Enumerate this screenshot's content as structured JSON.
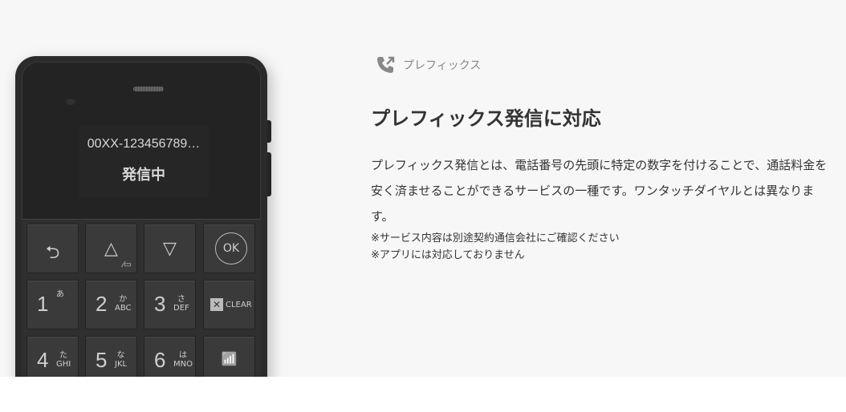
{
  "phone": {
    "display_number": "00XX-123456789…",
    "display_status": "発信中",
    "keys": [
      {
        "label": "back",
        "glyph": "⮌"
      },
      {
        "label": "up",
        "glyph": "△",
        "sub": "⁄▭"
      },
      {
        "label": "down",
        "glyph": "▽"
      },
      {
        "label": "ok",
        "glyph": "OK"
      },
      {
        "digit": "1",
        "kana": "あ",
        "alpha": ""
      },
      {
        "digit": "2",
        "kana": "か",
        "alpha": "ABC"
      },
      {
        "digit": "3",
        "kana": "さ",
        "alpha": "DEF"
      },
      {
        "label": "clear",
        "glyph": "✕",
        "text": "CLEAR"
      },
      {
        "digit": "4",
        "kana": "た",
        "alpha": "GHI"
      },
      {
        "digit": "5",
        "kana": "な",
        "alpha": "JKL"
      },
      {
        "digit": "6",
        "kana": "は",
        "alpha": "MNO"
      },
      {
        "label": "tethering",
        "glyph": "📶"
      }
    ]
  },
  "feature": {
    "icon": "phone-prefix-icon",
    "tag": "プレフィックス",
    "title": "プレフィックス発信に対応",
    "body": "プレフィックス発信とは、電話番号の先頭に特定の数字を付けることで、通話料金を安く済ませることができるサービスの一種です。ワンタッチダイヤルとは異なります。",
    "notes": [
      "※サービス内容は別途契約通信会社にご確認ください",
      "※アプリには対応しておりません"
    ]
  }
}
